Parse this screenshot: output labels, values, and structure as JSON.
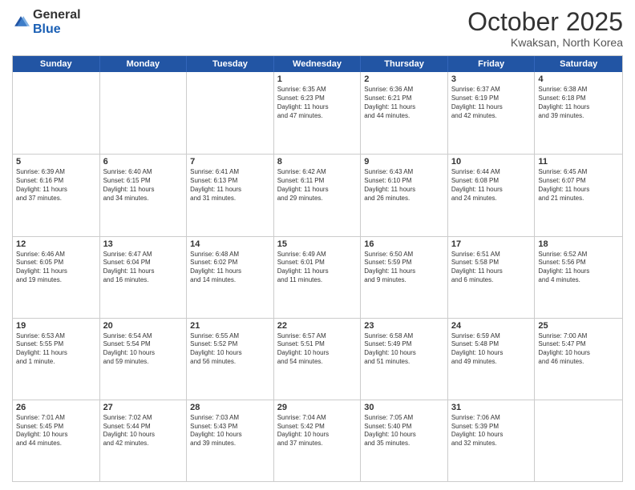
{
  "header": {
    "logo_general": "General",
    "logo_blue": "Blue",
    "month_title": "October 2025",
    "location": "Kwaksan, North Korea"
  },
  "days_of_week": [
    "Sunday",
    "Monday",
    "Tuesday",
    "Wednesday",
    "Thursday",
    "Friday",
    "Saturday"
  ],
  "weeks": [
    [
      {
        "day": "",
        "empty": true
      },
      {
        "day": "",
        "empty": true
      },
      {
        "day": "",
        "empty": true
      },
      {
        "day": "1",
        "lines": [
          "Sunrise: 6:35 AM",
          "Sunset: 6:23 PM",
          "Daylight: 11 hours",
          "and 47 minutes."
        ]
      },
      {
        "day": "2",
        "lines": [
          "Sunrise: 6:36 AM",
          "Sunset: 6:21 PM",
          "Daylight: 11 hours",
          "and 44 minutes."
        ]
      },
      {
        "day": "3",
        "lines": [
          "Sunrise: 6:37 AM",
          "Sunset: 6:19 PM",
          "Daylight: 11 hours",
          "and 42 minutes."
        ]
      },
      {
        "day": "4",
        "lines": [
          "Sunrise: 6:38 AM",
          "Sunset: 6:18 PM",
          "Daylight: 11 hours",
          "and 39 minutes."
        ]
      }
    ],
    [
      {
        "day": "5",
        "lines": [
          "Sunrise: 6:39 AM",
          "Sunset: 6:16 PM",
          "Daylight: 11 hours",
          "and 37 minutes."
        ]
      },
      {
        "day": "6",
        "lines": [
          "Sunrise: 6:40 AM",
          "Sunset: 6:15 PM",
          "Daylight: 11 hours",
          "and 34 minutes."
        ]
      },
      {
        "day": "7",
        "lines": [
          "Sunrise: 6:41 AM",
          "Sunset: 6:13 PM",
          "Daylight: 11 hours",
          "and 31 minutes."
        ]
      },
      {
        "day": "8",
        "lines": [
          "Sunrise: 6:42 AM",
          "Sunset: 6:11 PM",
          "Daylight: 11 hours",
          "and 29 minutes."
        ]
      },
      {
        "day": "9",
        "lines": [
          "Sunrise: 6:43 AM",
          "Sunset: 6:10 PM",
          "Daylight: 11 hours",
          "and 26 minutes."
        ]
      },
      {
        "day": "10",
        "lines": [
          "Sunrise: 6:44 AM",
          "Sunset: 6:08 PM",
          "Daylight: 11 hours",
          "and 24 minutes."
        ]
      },
      {
        "day": "11",
        "lines": [
          "Sunrise: 6:45 AM",
          "Sunset: 6:07 PM",
          "Daylight: 11 hours",
          "and 21 minutes."
        ]
      }
    ],
    [
      {
        "day": "12",
        "lines": [
          "Sunrise: 6:46 AM",
          "Sunset: 6:05 PM",
          "Daylight: 11 hours",
          "and 19 minutes."
        ]
      },
      {
        "day": "13",
        "lines": [
          "Sunrise: 6:47 AM",
          "Sunset: 6:04 PM",
          "Daylight: 11 hours",
          "and 16 minutes."
        ]
      },
      {
        "day": "14",
        "lines": [
          "Sunrise: 6:48 AM",
          "Sunset: 6:02 PM",
          "Daylight: 11 hours",
          "and 14 minutes."
        ]
      },
      {
        "day": "15",
        "lines": [
          "Sunrise: 6:49 AM",
          "Sunset: 6:01 PM",
          "Daylight: 11 hours",
          "and 11 minutes."
        ]
      },
      {
        "day": "16",
        "lines": [
          "Sunrise: 6:50 AM",
          "Sunset: 5:59 PM",
          "Daylight: 11 hours",
          "and 9 minutes."
        ]
      },
      {
        "day": "17",
        "lines": [
          "Sunrise: 6:51 AM",
          "Sunset: 5:58 PM",
          "Daylight: 11 hours",
          "and 6 minutes."
        ]
      },
      {
        "day": "18",
        "lines": [
          "Sunrise: 6:52 AM",
          "Sunset: 5:56 PM",
          "Daylight: 11 hours",
          "and 4 minutes."
        ]
      }
    ],
    [
      {
        "day": "19",
        "lines": [
          "Sunrise: 6:53 AM",
          "Sunset: 5:55 PM",
          "Daylight: 11 hours",
          "and 1 minute."
        ]
      },
      {
        "day": "20",
        "lines": [
          "Sunrise: 6:54 AM",
          "Sunset: 5:54 PM",
          "Daylight: 10 hours",
          "and 59 minutes."
        ]
      },
      {
        "day": "21",
        "lines": [
          "Sunrise: 6:55 AM",
          "Sunset: 5:52 PM",
          "Daylight: 10 hours",
          "and 56 minutes."
        ]
      },
      {
        "day": "22",
        "lines": [
          "Sunrise: 6:57 AM",
          "Sunset: 5:51 PM",
          "Daylight: 10 hours",
          "and 54 minutes."
        ]
      },
      {
        "day": "23",
        "lines": [
          "Sunrise: 6:58 AM",
          "Sunset: 5:49 PM",
          "Daylight: 10 hours",
          "and 51 minutes."
        ]
      },
      {
        "day": "24",
        "lines": [
          "Sunrise: 6:59 AM",
          "Sunset: 5:48 PM",
          "Daylight: 10 hours",
          "and 49 minutes."
        ]
      },
      {
        "day": "25",
        "lines": [
          "Sunrise: 7:00 AM",
          "Sunset: 5:47 PM",
          "Daylight: 10 hours",
          "and 46 minutes."
        ]
      }
    ],
    [
      {
        "day": "26",
        "lines": [
          "Sunrise: 7:01 AM",
          "Sunset: 5:45 PM",
          "Daylight: 10 hours",
          "and 44 minutes."
        ]
      },
      {
        "day": "27",
        "lines": [
          "Sunrise: 7:02 AM",
          "Sunset: 5:44 PM",
          "Daylight: 10 hours",
          "and 42 minutes."
        ]
      },
      {
        "day": "28",
        "lines": [
          "Sunrise: 7:03 AM",
          "Sunset: 5:43 PM",
          "Daylight: 10 hours",
          "and 39 minutes."
        ]
      },
      {
        "day": "29",
        "lines": [
          "Sunrise: 7:04 AM",
          "Sunset: 5:42 PM",
          "Daylight: 10 hours",
          "and 37 minutes."
        ]
      },
      {
        "day": "30",
        "lines": [
          "Sunrise: 7:05 AM",
          "Sunset: 5:40 PM",
          "Daylight: 10 hours",
          "and 35 minutes."
        ]
      },
      {
        "day": "31",
        "lines": [
          "Sunrise: 7:06 AM",
          "Sunset: 5:39 PM",
          "Daylight: 10 hours",
          "and 32 minutes."
        ]
      },
      {
        "day": "",
        "empty": true
      }
    ]
  ]
}
